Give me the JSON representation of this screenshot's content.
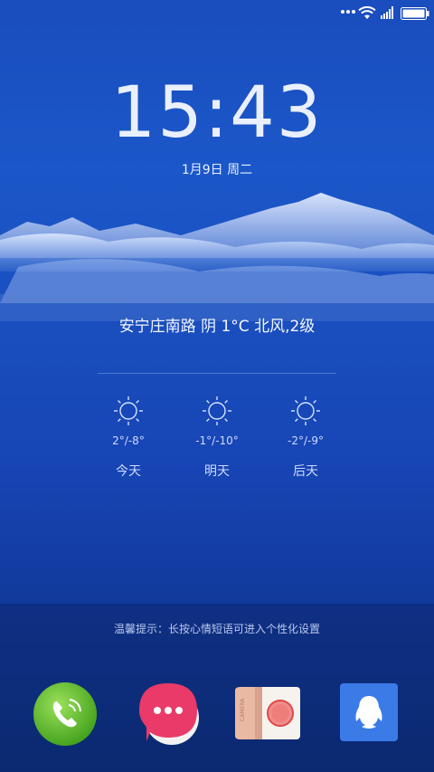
{
  "status_bar": {
    "icons": [
      "dots-icon",
      "wifi-icon",
      "signal-icon",
      "battery-icon"
    ]
  },
  "lockscreen": {
    "time": "15:43",
    "date": "1月9日 周二",
    "current_weather": "安宁庄南路 阴 1°C 北风,2级"
  },
  "forecast": [
    {
      "icon": "sun-icon",
      "temp": "2°/-8°",
      "label": "今天"
    },
    {
      "icon": "sun-icon",
      "temp": "-1°/-10°",
      "label": "明天"
    },
    {
      "icon": "sun-icon",
      "temp": "-2°/-9°",
      "label": "后天"
    }
  ],
  "hint": "温馨提示：长按心情短语可进入个性化设置",
  "dock": {
    "apps": [
      "phone-app",
      "messages-app",
      "camera-app",
      "qq-app"
    ]
  }
}
